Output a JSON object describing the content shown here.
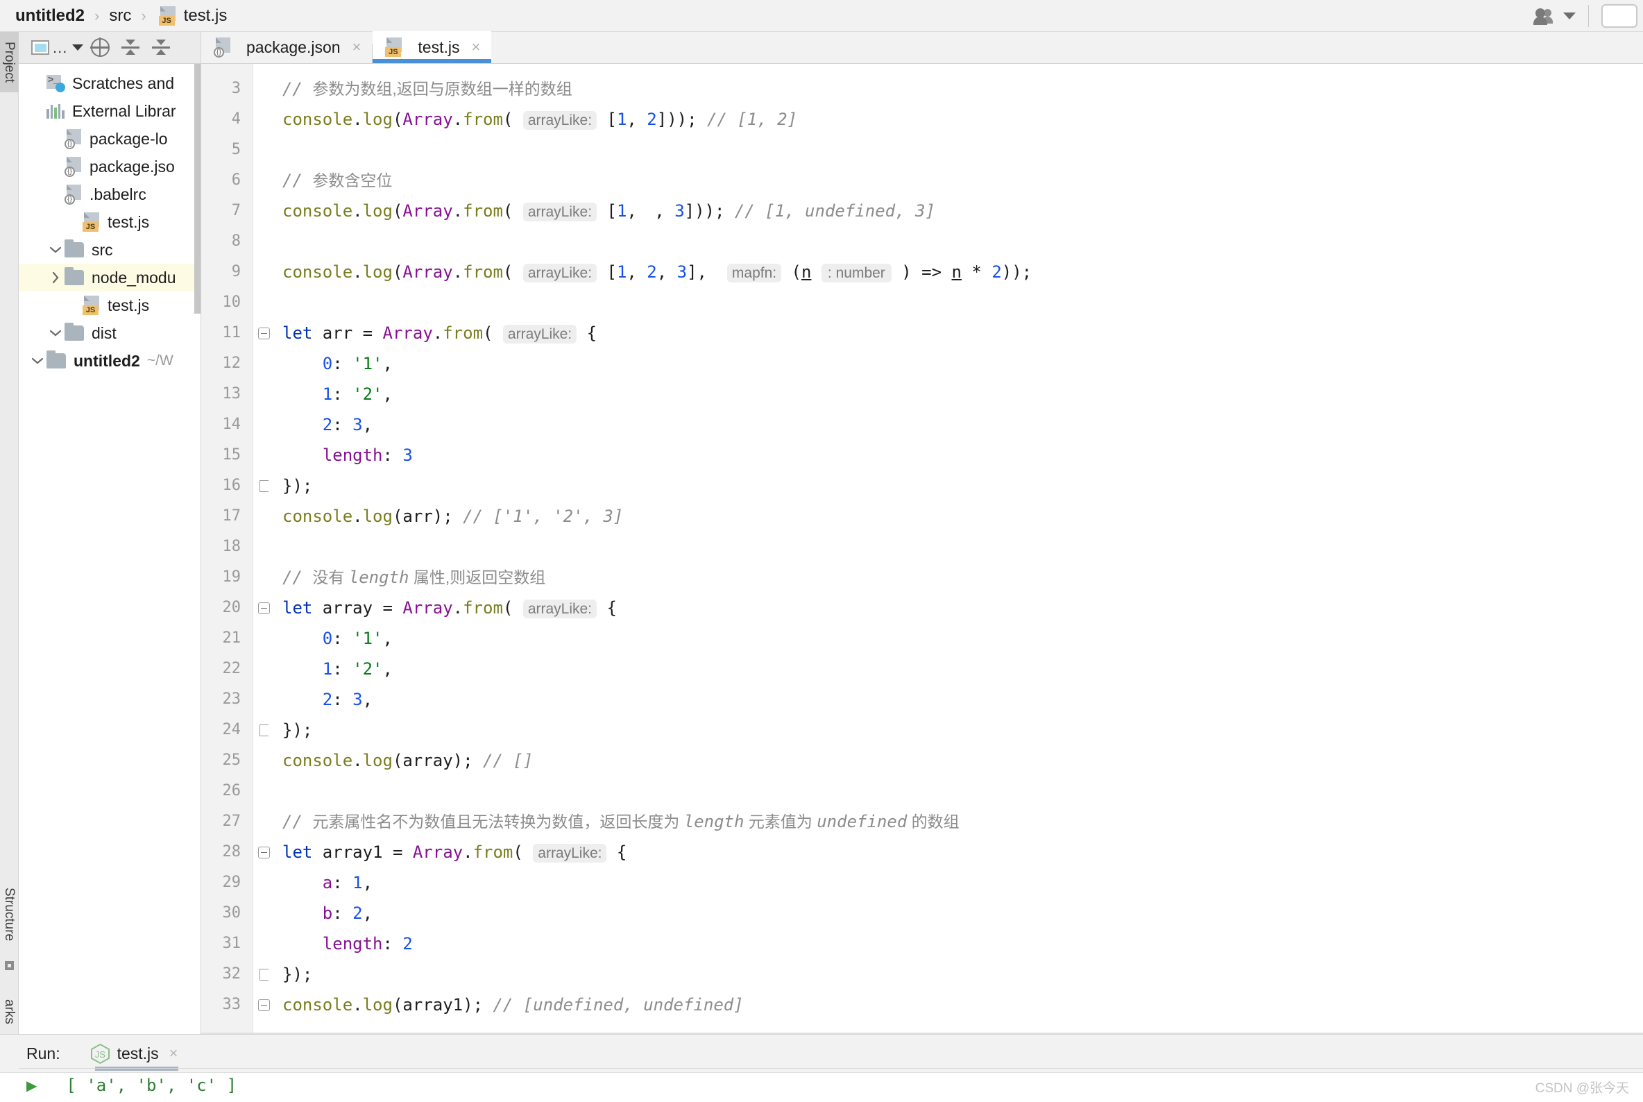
{
  "window": {
    "breadcrumb": [
      {
        "label": "untitled2",
        "bold": true,
        "icon": "none"
      },
      {
        "label": "src",
        "bold": false,
        "icon": "none"
      },
      {
        "label": "test.js",
        "bold": false,
        "icon": "js-file-icon"
      }
    ],
    "separator": "›",
    "account_icon": "user-accounts-icon",
    "watermark": "CSDN @张今天"
  },
  "left_strip": {
    "tabs": [
      {
        "label": "Project",
        "selected": true
      },
      {
        "label": "Structure",
        "selected": false
      },
      {
        "label": "arks",
        "selected": false
      }
    ]
  },
  "project_panel": {
    "toolbar": [
      {
        "name": "scope-selector",
        "icon": "window-icon",
        "label": "..."
      },
      {
        "name": "locate-file",
        "icon": "target-icon"
      },
      {
        "name": "collapse-all",
        "icon": "collapse-all-icon"
      },
      {
        "name": "expand-all",
        "icon": "expand-all-icon"
      }
    ],
    "tree": [
      {
        "depth": 0,
        "chevron": "down",
        "icon": "folder-icon",
        "label": "untitled2",
        "suffix": "~/W",
        "bold": true,
        "highlight": false
      },
      {
        "depth": 1,
        "chevron": "down",
        "icon": "folder-icon",
        "label": "dist",
        "suffix": "",
        "bold": false,
        "highlight": false
      },
      {
        "depth": 2,
        "chevron": "none",
        "icon": "js-file-icon",
        "label": "test.js",
        "suffix": "",
        "bold": false,
        "highlight": false
      },
      {
        "depth": 1,
        "chevron": "right",
        "icon": "folder-icon",
        "label": "node_modu",
        "suffix": "",
        "bold": false,
        "highlight": true
      },
      {
        "depth": 1,
        "chevron": "down",
        "icon": "folder-icon",
        "label": "src",
        "suffix": "",
        "bold": false,
        "highlight": false
      },
      {
        "depth": 2,
        "chevron": "none",
        "icon": "js-file-icon",
        "label": "test.js",
        "suffix": "",
        "bold": false,
        "highlight": false
      },
      {
        "depth": 1,
        "chevron": "none",
        "icon": "json-file-icon",
        "label": ".babelrc",
        "suffix": "",
        "bold": false,
        "highlight": false
      },
      {
        "depth": 1,
        "chevron": "none",
        "icon": "json-file-icon",
        "label": "package.jso",
        "suffix": "",
        "bold": false,
        "highlight": false
      },
      {
        "depth": 1,
        "chevron": "none",
        "icon": "json-file-icon",
        "label": "package-lo",
        "suffix": "",
        "bold": false,
        "highlight": false
      },
      {
        "depth": 0,
        "chevron": "none",
        "icon": "library-icon",
        "label": "External Librar",
        "suffix": "",
        "bold": false,
        "highlight": false
      },
      {
        "depth": 0,
        "chevron": "none",
        "icon": "scratches-icon",
        "label": "Scratches and",
        "suffix": "",
        "bold": false,
        "highlight": false
      }
    ]
  },
  "editor": {
    "tabs": [
      {
        "label": "package.json",
        "icon": "json-file-icon",
        "active": false,
        "close": "×"
      },
      {
        "label": "test.js",
        "icon": "js-file-icon",
        "active": true,
        "close": "×"
      }
    ],
    "first_line_number": 3,
    "lines": [
      {
        "n": 3,
        "fold": "none",
        "tokens": [
          {
            "t": "cmt",
            "v": "// "
          },
          {
            "t": "cmt-cn",
            "v": "参数为数组,返回与原数组一样的数组"
          }
        ]
      },
      {
        "n": 4,
        "fold": "none",
        "tokens": [
          {
            "t": "fn",
            "v": "console"
          },
          {
            "t": "pln",
            "v": "."
          },
          {
            "t": "fn",
            "v": "log"
          },
          {
            "t": "pln",
            "v": "("
          },
          {
            "t": "cls",
            "v": "Array"
          },
          {
            "t": "pln",
            "v": "."
          },
          {
            "t": "fn",
            "v": "from"
          },
          {
            "t": "pln",
            "v": "( "
          },
          {
            "t": "hint",
            "v": "arrayLike:"
          },
          {
            "t": "pln",
            "v": " ["
          },
          {
            "t": "num",
            "v": "1"
          },
          {
            "t": "pln",
            "v": ", "
          },
          {
            "t": "num",
            "v": "2"
          },
          {
            "t": "pln",
            "v": "])); "
          },
          {
            "t": "cmt",
            "v": "// [1, 2]"
          }
        ]
      },
      {
        "n": 5,
        "fold": "none",
        "tokens": []
      },
      {
        "n": 6,
        "fold": "none",
        "tokens": [
          {
            "t": "cmt",
            "v": "// "
          },
          {
            "t": "cmt-cn",
            "v": "参数含空位"
          }
        ]
      },
      {
        "n": 7,
        "fold": "none",
        "tokens": [
          {
            "t": "fn",
            "v": "console"
          },
          {
            "t": "pln",
            "v": "."
          },
          {
            "t": "fn",
            "v": "log"
          },
          {
            "t": "pln",
            "v": "("
          },
          {
            "t": "cls",
            "v": "Array"
          },
          {
            "t": "pln",
            "v": "."
          },
          {
            "t": "fn",
            "v": "from"
          },
          {
            "t": "pln",
            "v": "( "
          },
          {
            "t": "hint",
            "v": "arrayLike:"
          },
          {
            "t": "pln",
            "v": " ["
          },
          {
            "t": "num",
            "v": "1"
          },
          {
            "t": "pln",
            "v": ", "
          },
          {
            "t": "slot",
            "v": ","
          },
          {
            "t": "pln",
            "v": " "
          },
          {
            "t": "num",
            "v": "3"
          },
          {
            "t": "pln",
            "v": "])); "
          },
          {
            "t": "cmt",
            "v": "// [1, undefined, 3]"
          }
        ]
      },
      {
        "n": 8,
        "fold": "none",
        "tokens": []
      },
      {
        "n": 9,
        "fold": "none",
        "tokens": [
          {
            "t": "fn",
            "v": "console"
          },
          {
            "t": "pln",
            "v": "."
          },
          {
            "t": "fn",
            "v": "log"
          },
          {
            "t": "pln",
            "v": "("
          },
          {
            "t": "cls",
            "v": "Array"
          },
          {
            "t": "pln",
            "v": "."
          },
          {
            "t": "fn",
            "v": "from"
          },
          {
            "t": "pln",
            "v": "( "
          },
          {
            "t": "hint",
            "v": "arrayLike:"
          },
          {
            "t": "pln",
            "v": " ["
          },
          {
            "t": "num",
            "v": "1"
          },
          {
            "t": "pln",
            "v": ", "
          },
          {
            "t": "num",
            "v": "2"
          },
          {
            "t": "pln",
            "v": ", "
          },
          {
            "t": "num",
            "v": "3"
          },
          {
            "t": "pln",
            "v": "],  "
          },
          {
            "t": "hint",
            "v": "mapfn:"
          },
          {
            "t": "pln",
            "v": " ("
          },
          {
            "t": "uline",
            "v": "n"
          },
          {
            "t": "pln",
            "v": " "
          },
          {
            "t": "hint2",
            "v": ": number"
          },
          {
            "t": "pln",
            "v": " ) => "
          },
          {
            "t": "uline",
            "v": "n"
          },
          {
            "t": "pln",
            "v": " * "
          },
          {
            "t": "num",
            "v": "2"
          },
          {
            "t": "pln",
            "v": "));"
          }
        ]
      },
      {
        "n": 10,
        "fold": "none",
        "tokens": []
      },
      {
        "n": 11,
        "fold": "start",
        "tokens": [
          {
            "t": "kw",
            "v": "let"
          },
          {
            "t": "pln",
            "v": " arr = "
          },
          {
            "t": "cls",
            "v": "Array"
          },
          {
            "t": "pln",
            "v": "."
          },
          {
            "t": "fn",
            "v": "from"
          },
          {
            "t": "pln",
            "v": "( "
          },
          {
            "t": "hint",
            "v": "arrayLike:"
          },
          {
            "t": "pln",
            "v": " {"
          }
        ]
      },
      {
        "n": 12,
        "fold": "none",
        "tokens": [
          {
            "t": "pln",
            "v": "    "
          },
          {
            "t": "num",
            "v": "0"
          },
          {
            "t": "pln",
            "v": ": "
          },
          {
            "t": "str",
            "v": "'1'"
          },
          {
            "t": "pln",
            "v": ","
          }
        ]
      },
      {
        "n": 13,
        "fold": "none",
        "tokens": [
          {
            "t": "pln",
            "v": "    "
          },
          {
            "t": "num",
            "v": "1"
          },
          {
            "t": "pln",
            "v": ": "
          },
          {
            "t": "str",
            "v": "'2'"
          },
          {
            "t": "pln",
            "v": ","
          }
        ]
      },
      {
        "n": 14,
        "fold": "none",
        "tokens": [
          {
            "t": "pln",
            "v": "    "
          },
          {
            "t": "num",
            "v": "2"
          },
          {
            "t": "pln",
            "v": ": "
          },
          {
            "t": "num",
            "v": "3"
          },
          {
            "t": "pln",
            "v": ","
          }
        ]
      },
      {
        "n": 15,
        "fold": "none",
        "tokens": [
          {
            "t": "pln",
            "v": "    "
          },
          {
            "t": "prop",
            "v": "length"
          },
          {
            "t": "pln",
            "v": ": "
          },
          {
            "t": "num",
            "v": "3"
          }
        ]
      },
      {
        "n": 16,
        "fold": "end",
        "tokens": [
          {
            "t": "pln",
            "v": "});"
          }
        ]
      },
      {
        "n": 17,
        "fold": "none",
        "tokens": [
          {
            "t": "fn",
            "v": "console"
          },
          {
            "t": "pln",
            "v": "."
          },
          {
            "t": "fn",
            "v": "log"
          },
          {
            "t": "pln",
            "v": "(arr); "
          },
          {
            "t": "cmt",
            "v": "// ['1', '2', 3]"
          }
        ]
      },
      {
        "n": 18,
        "fold": "none",
        "tokens": []
      },
      {
        "n": 19,
        "fold": "none",
        "tokens": [
          {
            "t": "cmt",
            "v": "// "
          },
          {
            "t": "cmt-cn",
            "v": "没有 "
          },
          {
            "t": "cmt",
            "v": "length"
          },
          {
            "t": "cmt-cn",
            "v": " 属性,则返回空数组"
          }
        ]
      },
      {
        "n": 20,
        "fold": "start",
        "tokens": [
          {
            "t": "kw",
            "v": "let"
          },
          {
            "t": "pln",
            "v": " array = "
          },
          {
            "t": "cls",
            "v": "Array"
          },
          {
            "t": "pln",
            "v": "."
          },
          {
            "t": "fn",
            "v": "from"
          },
          {
            "t": "pln",
            "v": "( "
          },
          {
            "t": "hint",
            "v": "arrayLike:"
          },
          {
            "t": "pln",
            "v": " {"
          }
        ]
      },
      {
        "n": 21,
        "fold": "none",
        "tokens": [
          {
            "t": "pln",
            "v": "    "
          },
          {
            "t": "num",
            "v": "0"
          },
          {
            "t": "pln",
            "v": ": "
          },
          {
            "t": "str",
            "v": "'1'"
          },
          {
            "t": "pln",
            "v": ","
          }
        ]
      },
      {
        "n": 22,
        "fold": "none",
        "tokens": [
          {
            "t": "pln",
            "v": "    "
          },
          {
            "t": "num",
            "v": "1"
          },
          {
            "t": "pln",
            "v": ": "
          },
          {
            "t": "str",
            "v": "'2'"
          },
          {
            "t": "pln",
            "v": ","
          }
        ]
      },
      {
        "n": 23,
        "fold": "none",
        "tokens": [
          {
            "t": "pln",
            "v": "    "
          },
          {
            "t": "num",
            "v": "2"
          },
          {
            "t": "pln",
            "v": ": "
          },
          {
            "t": "num",
            "v": "3"
          },
          {
            "t": "pln",
            "v": ","
          }
        ]
      },
      {
        "n": 24,
        "fold": "end",
        "tokens": [
          {
            "t": "pln",
            "v": "});"
          }
        ]
      },
      {
        "n": 25,
        "fold": "none",
        "tokens": [
          {
            "t": "fn",
            "v": "console"
          },
          {
            "t": "pln",
            "v": "."
          },
          {
            "t": "fn",
            "v": "log"
          },
          {
            "t": "pln",
            "v": "(array); "
          },
          {
            "t": "cmt",
            "v": "// []"
          }
        ]
      },
      {
        "n": 26,
        "fold": "none",
        "tokens": []
      },
      {
        "n": 27,
        "fold": "none",
        "tokens": [
          {
            "t": "cmt",
            "v": "// "
          },
          {
            "t": "cmt-cn",
            "v": "元素属性名不为数值且无法转换为数值，返回长度为 "
          },
          {
            "t": "cmt",
            "v": "length"
          },
          {
            "t": "cmt-cn",
            "v": " 元素值为 "
          },
          {
            "t": "cmt",
            "v": "undefined"
          },
          {
            "t": "cmt-cn",
            "v": " 的数组"
          }
        ]
      },
      {
        "n": 28,
        "fold": "start",
        "tokens": [
          {
            "t": "kw",
            "v": "let"
          },
          {
            "t": "pln",
            "v": " array1 = "
          },
          {
            "t": "cls",
            "v": "Array"
          },
          {
            "t": "pln",
            "v": "."
          },
          {
            "t": "fn",
            "v": "from"
          },
          {
            "t": "pln",
            "v": "( "
          },
          {
            "t": "hint",
            "v": "arrayLike:"
          },
          {
            "t": "pln",
            "v": " {"
          }
        ]
      },
      {
        "n": 29,
        "fold": "none",
        "tokens": [
          {
            "t": "pln",
            "v": "    "
          },
          {
            "t": "prop",
            "v": "a"
          },
          {
            "t": "pln",
            "v": ": "
          },
          {
            "t": "num",
            "v": "1"
          },
          {
            "t": "pln",
            "v": ","
          }
        ]
      },
      {
        "n": 30,
        "fold": "none",
        "tokens": [
          {
            "t": "pln",
            "v": "    "
          },
          {
            "t": "prop",
            "v": "b"
          },
          {
            "t": "pln",
            "v": ": "
          },
          {
            "t": "num",
            "v": "2"
          },
          {
            "t": "pln",
            "v": ","
          }
        ]
      },
      {
        "n": 31,
        "fold": "none",
        "tokens": [
          {
            "t": "pln",
            "v": "    "
          },
          {
            "t": "prop",
            "v": "length"
          },
          {
            "t": "pln",
            "v": ": "
          },
          {
            "t": "num",
            "v": "2"
          }
        ]
      },
      {
        "n": 32,
        "fold": "end",
        "tokens": [
          {
            "t": "pln",
            "v": "});"
          }
        ]
      },
      {
        "n": 33,
        "fold": "start",
        "tokens": [
          {
            "t": "fn",
            "v": "console"
          },
          {
            "t": "pln",
            "v": "."
          },
          {
            "t": "fn",
            "v": "log"
          },
          {
            "t": "pln",
            "v": "(array1); "
          },
          {
            "t": "cmt",
            "v": "// [undefined, undefined]"
          }
        ]
      }
    ]
  },
  "run_panel": {
    "label": "Run:",
    "tab": {
      "label": "test.js",
      "icon": "nodejs-icon",
      "close": "×"
    },
    "output": "[ 'a', 'b', 'c' ]"
  },
  "colors": {
    "accent": "#4a90d9",
    "keyword": "#0033b3",
    "string": "#067d17",
    "number": "#1750eb",
    "comment": "#8c8c8c",
    "class": "#871094",
    "function": "#7a7d1e",
    "highlight_row": "#fdfbe3",
    "js_badge": "#f0c070"
  }
}
